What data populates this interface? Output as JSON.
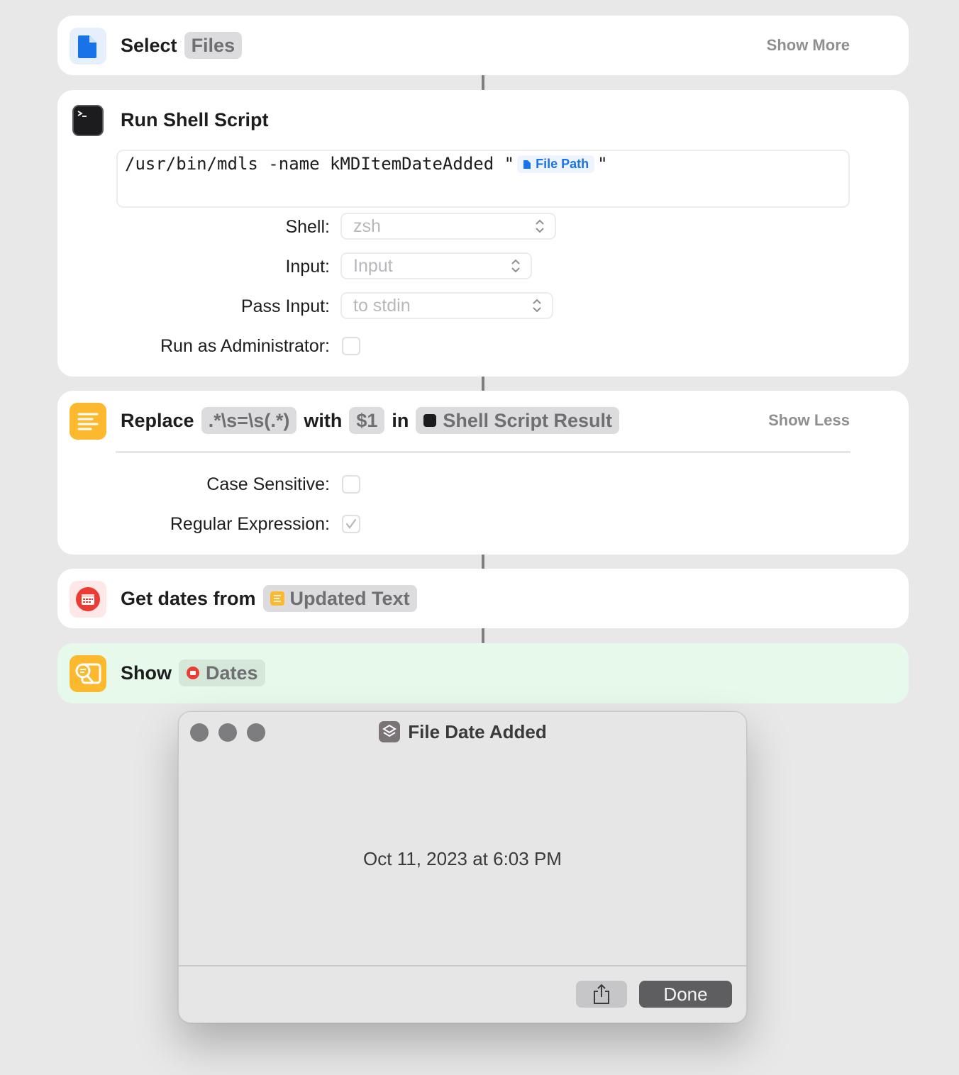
{
  "actions": {
    "select_files": {
      "verb": "Select",
      "token": "Files",
      "show_more": "Show More",
      "icon": "document-icon"
    },
    "run_shell": {
      "title": "Run Shell Script",
      "icon": "terminal-icon",
      "script_text": "/usr/bin/mdls -name kMDItemDateAdded \"",
      "script_var": "File Path",
      "script_end": "\"",
      "shell_label": "Shell:",
      "shell_value": "zsh",
      "input_label": "Input:",
      "input_value": "Input",
      "pass_input_label": "Pass Input:",
      "pass_input_value": "to stdin",
      "admin_label": "Run as Administrator:",
      "admin_checked": false
    },
    "replace": {
      "verb": "Replace",
      "pattern": ".*\\s=\\s(.*)",
      "with_word": "with",
      "replacement": "$1",
      "in_word": "in",
      "source": "Shell Script Result",
      "show_less": "Show Less",
      "case_label": "Case Sensitive:",
      "case_checked": false,
      "regex_label": "Regular Expression:",
      "regex_checked": true,
      "icon": "text-lines-icon"
    },
    "get_dates": {
      "verb": "Get dates from",
      "token": "Updated Text",
      "icon": "calendar-icon"
    },
    "show": {
      "verb": "Show",
      "token": "Dates",
      "icon": "quick-look-icon"
    }
  },
  "dialog": {
    "title": "File Date Added",
    "result": "Oct 11, 2023 at 6:03 PM",
    "done_label": "Done"
  },
  "colors": {
    "accent_blue": "#1a72e8",
    "action_yellow": "#fdb92e",
    "calendar_red": "#ec3b35",
    "show_card_green": "#e6f9ea"
  }
}
